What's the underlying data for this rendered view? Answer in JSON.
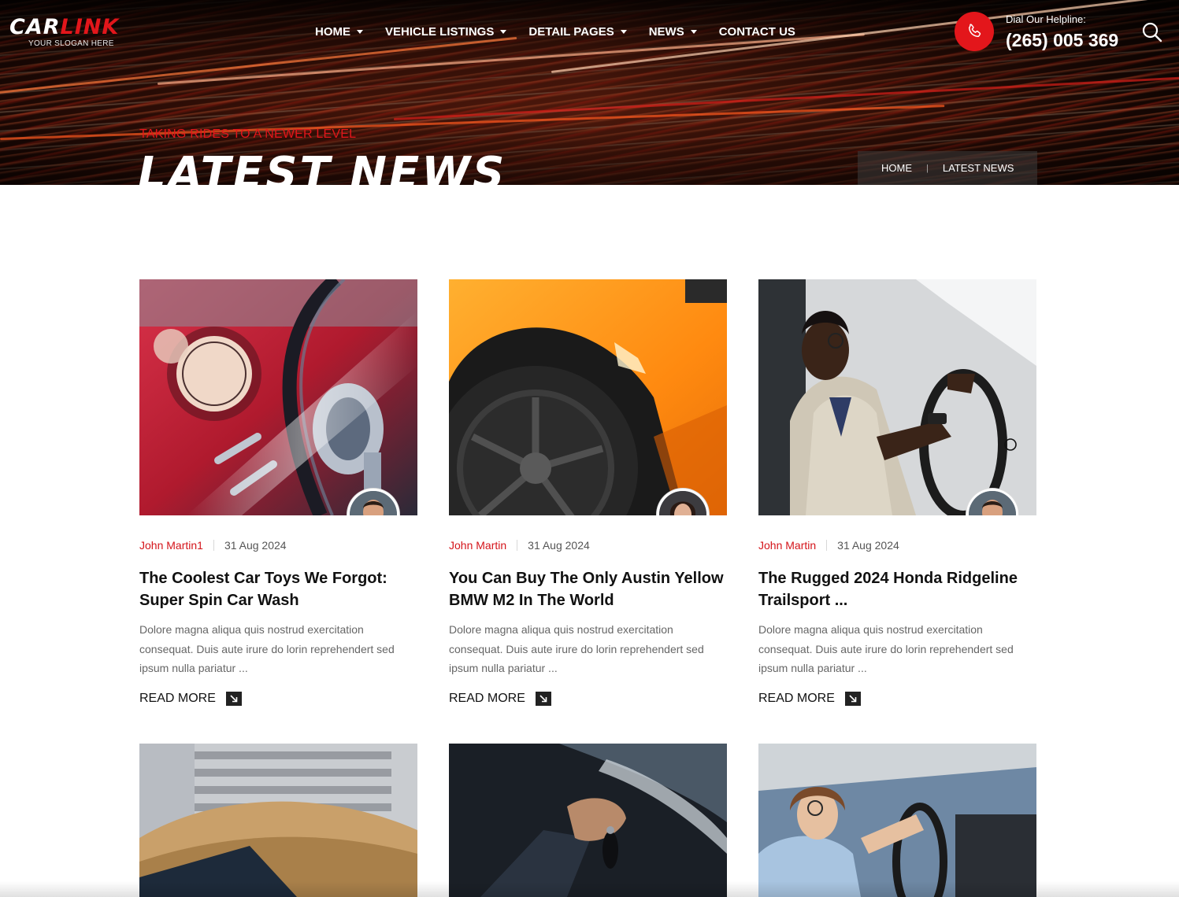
{
  "header": {
    "logo": {
      "part1": "CAR",
      "part2": "LINK",
      "slogan": "YOUR SLOGAN HERE"
    },
    "nav": [
      {
        "label": "HOME",
        "has_dropdown": true
      },
      {
        "label": "VEHICLE LISTINGS",
        "has_dropdown": true
      },
      {
        "label": "DETAIL PAGES",
        "has_dropdown": true
      },
      {
        "label": "NEWS",
        "has_dropdown": true
      },
      {
        "label": "CONTACT US",
        "has_dropdown": false
      }
    ],
    "helpline_label": "Dial Our Helpline:",
    "helpline_number": "(265) 005 369",
    "phone_icon": "phone-icon",
    "search_icon": "search-icon"
  },
  "hero": {
    "subtitle": "TAKING RIDES TO A NEWER LEVEL",
    "title": "LATEST NEWS",
    "breadcrumb": {
      "home": "HOME",
      "separator": "|",
      "current": "LATEST NEWS"
    }
  },
  "colors": {
    "accent": "#e3161b",
    "text": "#111111",
    "muted": "#666666"
  },
  "posts": [
    {
      "author": "John Martin1",
      "date": "31 Aug 2024",
      "title": "The Coolest Car Toys We Forgot: Super Spin Car Wash",
      "excerpt": "Dolore magna aliqua quis nostrud exercitation consequat. Duis aute irure do lorin reprehendert sed ipsum nulla pariatur ...",
      "read_more": "READ MORE"
    },
    {
      "author": "John Martin",
      "date": "31 Aug 2024",
      "title": "You Can Buy The Only Austin Yellow BMW M2 In The World",
      "excerpt": "Dolore magna aliqua quis nostrud exercitation consequat. Duis aute irure do lorin reprehendert sed ipsum nulla pariatur ...",
      "read_more": "READ MORE"
    },
    {
      "author": "John Martin",
      "date": "31 Aug 2024",
      "title": "The Rugged 2024 Honda Ridgeline Trailsport ...",
      "excerpt": "Dolore magna aliqua quis nostrud exercitation consequat. Duis aute irure do lorin reprehendert sed ipsum nulla pariatur ...",
      "read_more": "READ MORE"
    }
  ]
}
